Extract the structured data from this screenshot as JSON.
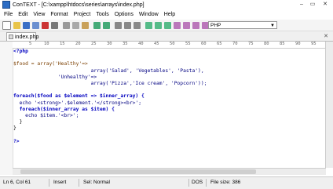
{
  "window": {
    "title": "ConTEXT - [C:\\xampp\\htdocs\\series\\arrays\\index.php]"
  },
  "menu": [
    "File",
    "Edit",
    "View",
    "Format",
    "Project",
    "Tools",
    "Options",
    "Window",
    "Help"
  ],
  "toolbar": {
    "language": "PHP"
  },
  "tabs": [
    {
      "label": "index.php"
    }
  ],
  "ruler": {
    "marks": [
      "5",
      "10",
      "15",
      "20",
      "25",
      "30",
      "35",
      "40",
      "45",
      "50",
      "55",
      "60",
      "65",
      "70",
      "75",
      "80",
      "85",
      "90",
      "95"
    ]
  },
  "code": {
    "lines": [
      "<?php",
      "",
      "$food = array('Healthy'=>",
      "                          array('Salad', 'Vegetables', 'Pasta'),",
      "               'Unhealthy'=>",
      "                          array('Pizza','Ice cream', 'Popcorn'));",
      "",
      "foreach($food as $element => $inner_array) {",
      "  echo '<strong>'.$element.'</strong><br>';",
      "  foreach($inner_array as $item) {",
      "    echo $item.'<br>';",
      "  }",
      "}",
      "",
      "?>"
    ]
  },
  "status": {
    "position": "Ln 6, Col 61",
    "mode": "Insert",
    "selection": "Sel: Normal",
    "format": "DOS",
    "filesize": "File size: 386"
  }
}
